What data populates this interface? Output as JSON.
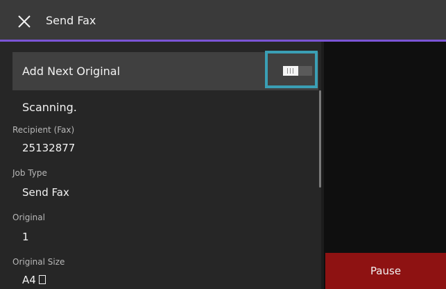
{
  "header": {
    "title": "Send Fax",
    "close_icon": "close-icon"
  },
  "job": {
    "add_next_original_label": "Add Next Original",
    "add_next_original_toggle": "on",
    "status": "Scanning.",
    "fields": [
      {
        "label": "Recipient (Fax)",
        "value": "25132877"
      },
      {
        "label": "Job Type",
        "value": "Send Fax"
      },
      {
        "label": "Original",
        "value": "1"
      },
      {
        "label": "Original Size",
        "value": "A4",
        "icon": "portrait-page-icon"
      }
    ]
  },
  "actions": {
    "pause_label": "Pause"
  },
  "colors": {
    "header_accent": "#7b55d6",
    "highlight": "#3a9fb5",
    "pause_button": "#8e1212"
  }
}
